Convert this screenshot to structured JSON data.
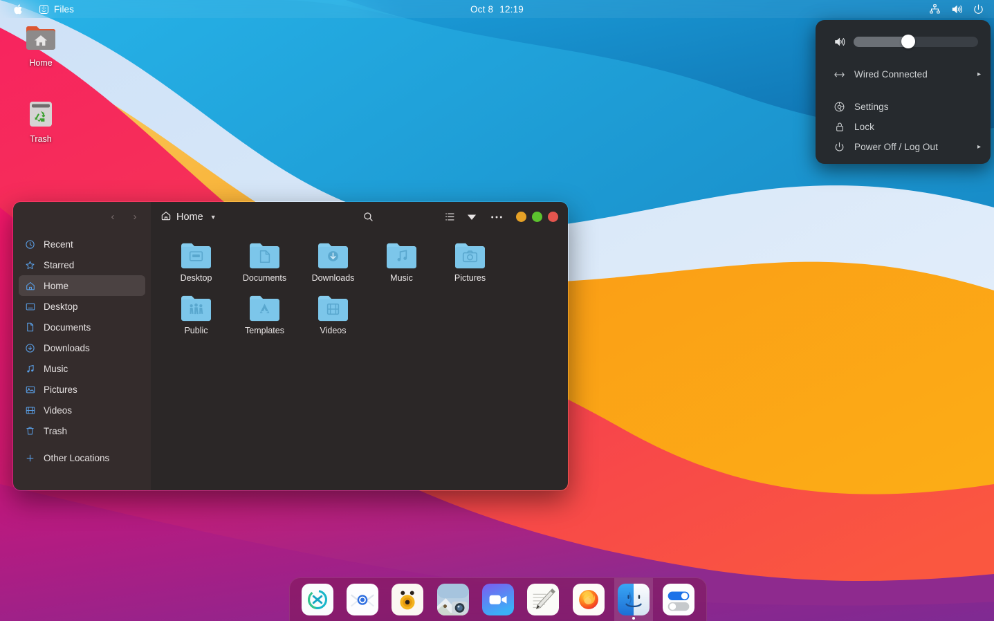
{
  "topbar": {
    "apple_icon": "apple-logo-icon",
    "app_name": "Files",
    "app_icon": "finder-icon",
    "clock_date": "Oct 8",
    "clock_time": "12:19",
    "right_icons": [
      "network-icon",
      "volume-icon",
      "power-icon"
    ]
  },
  "desktop": {
    "icons": [
      {
        "label": "Home",
        "icon": "home-folder-icon"
      },
      {
        "label": "Trash",
        "icon": "trash-icon"
      }
    ]
  },
  "system_menu": {
    "volume": {
      "icon": "volume-icon",
      "value": 44
    },
    "items": [
      {
        "label": "Wired Connected",
        "icon": "wired-network-icon",
        "has_submenu": true
      },
      {
        "label": "Settings",
        "icon": "gear-icon",
        "has_submenu": false
      },
      {
        "label": "Lock",
        "icon": "lock-icon",
        "has_submenu": false
      },
      {
        "label": "Power Off / Log Out",
        "icon": "power-icon",
        "has_submenu": true
      }
    ],
    "submenu_arrow": "▸"
  },
  "files_window": {
    "title": "Home",
    "title_icon": "home-icon",
    "nav": {
      "back": "‹",
      "forward": "›"
    },
    "header_buttons": [
      {
        "name": "search-button",
        "icon": "search-icon"
      },
      {
        "name": "list-view-button",
        "icon": "list-view-icon"
      },
      {
        "name": "view-options-button",
        "icon": "chevron-down-icon"
      },
      {
        "name": "menu-button",
        "icon": "ellipsis-icon"
      }
    ],
    "window_controls": [
      {
        "name": "minimize-button",
        "color": "#e6a126"
      },
      {
        "name": "maximize-button",
        "color": "#5cc32e"
      },
      {
        "name": "close-button",
        "color": "#e5554e"
      }
    ],
    "sidebar": [
      {
        "label": "Recent",
        "icon": "clock-icon",
        "active": false
      },
      {
        "label": "Starred",
        "icon": "star-icon",
        "active": false
      },
      {
        "label": "Home",
        "icon": "home-icon",
        "active": true
      },
      {
        "label": "Desktop",
        "icon": "desktop-icon",
        "active": false
      },
      {
        "label": "Documents",
        "icon": "documents-icon",
        "active": false
      },
      {
        "label": "Downloads",
        "icon": "download-icon",
        "active": false
      },
      {
        "label": "Music",
        "icon": "music-note-icon",
        "active": false
      },
      {
        "label": "Pictures",
        "icon": "picture-icon",
        "active": false
      },
      {
        "label": "Videos",
        "icon": "film-icon",
        "active": false
      },
      {
        "label": "Trash",
        "icon": "trash-icon",
        "active": false
      },
      {
        "label": "Other Locations",
        "icon": "plus-icon",
        "active": false
      }
    ],
    "files": [
      {
        "label": "Desktop",
        "emblem": "desktop-emblem"
      },
      {
        "label": "Documents",
        "emblem": "document-emblem"
      },
      {
        "label": "Downloads",
        "emblem": "download-emblem"
      },
      {
        "label": "Music",
        "emblem": "music-emblem"
      },
      {
        "label": "Pictures",
        "emblem": "camera-emblem"
      },
      {
        "label": "Public",
        "emblem": "people-emblem"
      },
      {
        "label": "Templates",
        "emblem": "template-emblem"
      },
      {
        "label": "Videos",
        "emblem": "film-emblem"
      }
    ]
  },
  "dock": {
    "items": [
      {
        "name": "remote-desktop-app",
        "icon": "remote-desktop-icon",
        "running": false
      },
      {
        "name": "mail-app",
        "icon": "mail-icon",
        "running": false
      },
      {
        "name": "sound-recorder-app",
        "icon": "sound-recorder-icon",
        "running": false
      },
      {
        "name": "photos-app",
        "icon": "photos-camera-icon",
        "running": false
      },
      {
        "name": "video-call-app",
        "icon": "video-camera-icon",
        "running": false
      },
      {
        "name": "notes-app",
        "icon": "notes-pencil-icon",
        "running": false
      },
      {
        "name": "firefox-app",
        "icon": "firefox-icon",
        "running": false
      },
      {
        "name": "files-app",
        "icon": "finder-icon",
        "running": true
      },
      {
        "name": "settings-app",
        "icon": "toggles-icon",
        "running": false
      }
    ]
  },
  "colors": {
    "accent_blue": "#5aa0e8",
    "folder_blue": "#7ec8ec",
    "sidebar_bg": "#342c2c",
    "content_bg": "#2b2727",
    "menu_bg": "#262a2e"
  }
}
